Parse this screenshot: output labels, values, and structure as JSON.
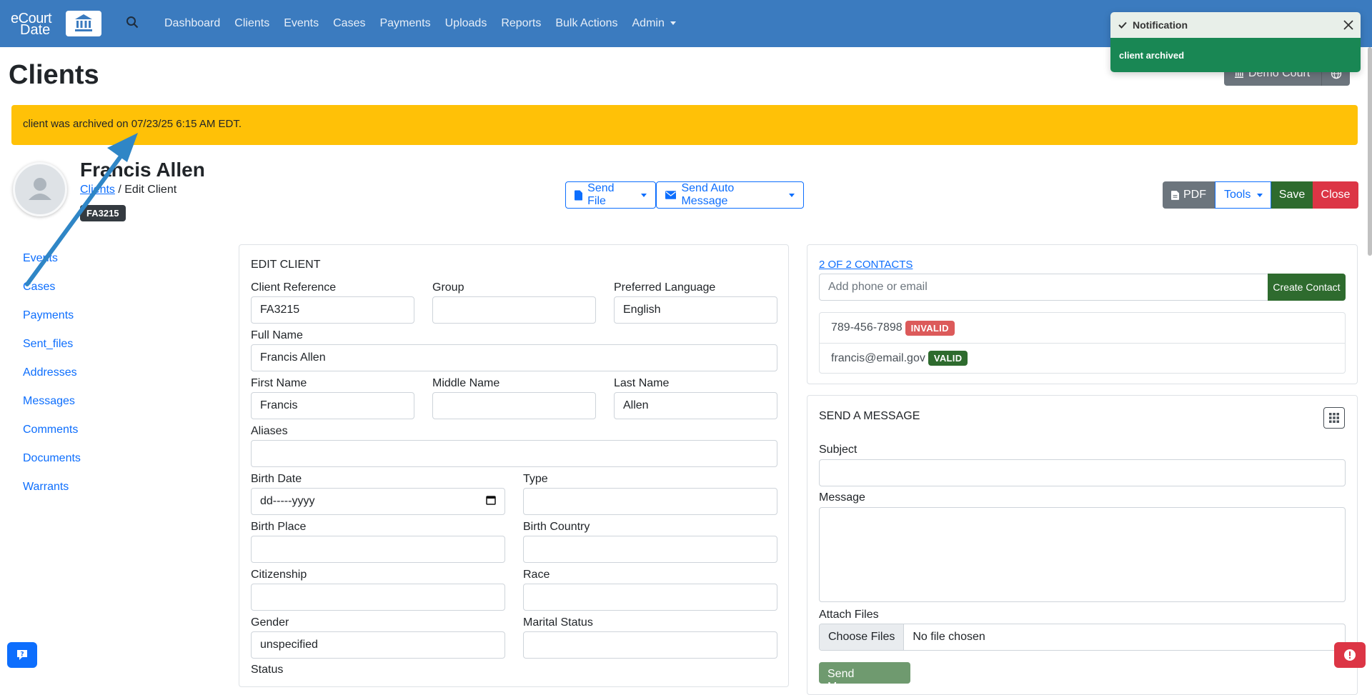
{
  "brand": {
    "line1": "eCourt",
    "line2": "Date"
  },
  "nav": {
    "links": [
      "Dashboard",
      "Clients",
      "Events",
      "Cases",
      "Payments",
      "Uploads",
      "Reports",
      "Bulk Actions",
      "Admin"
    ]
  },
  "page": {
    "title": "Clients",
    "court_label": "Demo Court"
  },
  "alert": {
    "text": "client was archived on 07/23/25 6:15 AM EDT."
  },
  "client": {
    "name": "Francis Allen",
    "breadcrumb_link": "Clients",
    "breadcrumb_current": "/ Edit Client",
    "reference_badge": "FA3215"
  },
  "actions": {
    "send_file": "Send File",
    "send_auto_message": "Send Auto Message",
    "pdf": "PDF",
    "tools": "Tools",
    "save": "Save",
    "close": "Close"
  },
  "sidebar": {
    "items": [
      "Events",
      "Cases",
      "Payments",
      "Sent_files",
      "Addresses",
      "Messages",
      "Comments",
      "Documents",
      "Warrants"
    ]
  },
  "edit_client": {
    "title": "EDIT CLIENT",
    "fields": {
      "client_reference": {
        "label": "Client Reference",
        "value": "FA3215"
      },
      "group": {
        "label": "Group",
        "value": ""
      },
      "preferred_language": {
        "label": "Preferred Language",
        "value": "English"
      },
      "full_name": {
        "label": "Full Name",
        "value": "Francis Allen"
      },
      "first_name": {
        "label": "First Name",
        "value": "Francis"
      },
      "middle_name": {
        "label": "Middle Name",
        "value": ""
      },
      "last_name": {
        "label": "Last Name",
        "value": "Allen"
      },
      "aliases": {
        "label": "Aliases",
        "value": ""
      },
      "birth_date": {
        "label": "Birth Date",
        "value": "dd-----yyyy"
      },
      "type": {
        "label": "Type",
        "value": ""
      },
      "birth_place": {
        "label": "Birth Place",
        "value": ""
      },
      "birth_country": {
        "label": "Birth Country",
        "value": ""
      },
      "citizenship": {
        "label": "Citizenship",
        "value": ""
      },
      "race": {
        "label": "Race",
        "value": ""
      },
      "gender": {
        "label": "Gender",
        "value": "unspecified"
      },
      "marital_status": {
        "label": "Marital Status",
        "value": ""
      },
      "status": {
        "label": "Status"
      }
    }
  },
  "contacts": {
    "link": "2 OF 2 CONTACTS",
    "input_placeholder": "Add phone or email",
    "create_button": "Create Contact",
    "list": [
      {
        "value": "789-456-7898",
        "status": "INVALID"
      },
      {
        "value": "francis@email.gov",
        "status": "VALID"
      }
    ]
  },
  "send_message": {
    "title": "SEND A MESSAGE",
    "subject_label": "Subject",
    "message_label": "Message",
    "attach_label": "Attach Files",
    "choose_files": "Choose Files",
    "no_file": "No file chosen",
    "send_button": "Send Message"
  },
  "toast": {
    "title": "Notification",
    "body": "client archived"
  },
  "colors": {
    "navbar": "#3b7bbf",
    "alert": "#ffc107",
    "success": "#198754",
    "danger": "#dc3545",
    "save": "#2e6b2e",
    "annotation_arrow": "#2f86c6"
  }
}
